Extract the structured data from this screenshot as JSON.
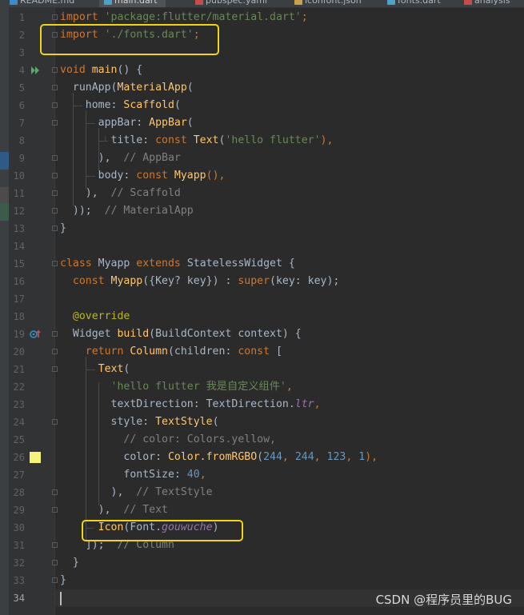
{
  "tabs": [
    {
      "label": "README.md",
      "icon_color": "#3d8bcd",
      "active": false
    },
    {
      "label": "main.dart",
      "icon_color": "#4ba3c7",
      "active": true
    },
    {
      "label": "pubspec.yaml",
      "icon_color": "#c94a4a",
      "active": false
    },
    {
      "label": "iconfont.json",
      "icon_color": "#c9a24a",
      "active": false
    },
    {
      "label": "fonts.dart",
      "icon_color": "#4ba3c7",
      "active": false
    },
    {
      "label": "analysis",
      "icon_color": "#c94a4a",
      "active": false
    }
  ],
  "editor": {
    "current_line": 34,
    "highlight_color": "#f2d316",
    "color_swatch": "#f4f47b",
    "lines": [
      [
        {
          "t": "import ",
          "c": "kw"
        },
        {
          "t": "'package:flutter/material.dart'",
          "c": "str"
        },
        {
          "t": ";",
          "c": "kw"
        }
      ],
      [
        {
          "t": "import ",
          "c": "kw"
        },
        {
          "t": "'./fonts.dart'",
          "c": "str"
        },
        {
          "t": ";",
          "c": "kw"
        }
      ],
      [],
      [
        {
          "t": "void ",
          "c": "kw"
        },
        {
          "t": "main",
          "c": "fn"
        },
        {
          "t": "() {",
          "c": ""
        }
      ],
      [
        {
          "t": "  runApp(",
          "c": ""
        },
        {
          "t": "MaterialApp",
          "c": "fn"
        },
        {
          "t": "(",
          "c": ""
        }
      ],
      [
        {
          "t": "    home: ",
          "c": ""
        },
        {
          "t": "Scaffold",
          "c": "fn"
        },
        {
          "t": "(",
          "c": ""
        }
      ],
      [
        {
          "t": "      appBar: ",
          "c": ""
        },
        {
          "t": "AppBar",
          "c": "fn"
        },
        {
          "t": "(",
          "c": ""
        }
      ],
      [
        {
          "t": "        title: ",
          "c": ""
        },
        {
          "t": "const ",
          "c": "kw"
        },
        {
          "t": "Text",
          "c": "fn"
        },
        {
          "t": "(",
          "c": ""
        },
        {
          "t": "'hello flutter'",
          "c": "str"
        },
        {
          "t": "),",
          "c": "kw"
        }
      ],
      [
        {
          "t": "      ),  ",
          "c": ""
        },
        {
          "t": "// AppBar",
          "c": "cm"
        }
      ],
      [
        {
          "t": "      body: ",
          "c": ""
        },
        {
          "t": "const ",
          "c": "kw"
        },
        {
          "t": "Myapp",
          "c": "fn"
        },
        {
          "t": "(),",
          "c": "kw"
        }
      ],
      [
        {
          "t": "    ),  ",
          "c": ""
        },
        {
          "t": "// Scaffold",
          "c": "cm"
        }
      ],
      [
        {
          "t": "  ));  ",
          "c": ""
        },
        {
          "t": "// MaterialApp",
          "c": "cm"
        }
      ],
      [
        {
          "t": "}",
          "c": ""
        }
      ],
      [],
      [
        {
          "t": "class ",
          "c": "kw"
        },
        {
          "t": "Myapp ",
          "c": ""
        },
        {
          "t": "extends ",
          "c": "kw"
        },
        {
          "t": "StatelessWidget {",
          "c": ""
        }
      ],
      [
        {
          "t": "  const ",
          "c": "kw"
        },
        {
          "t": "Myapp",
          "c": "fn"
        },
        {
          "t": "({Key? key}) : ",
          "c": ""
        },
        {
          "t": "super",
          "c": "kw"
        },
        {
          "t": "(key: key);",
          "c": ""
        }
      ],
      [],
      [
        {
          "t": "  @override",
          "c": "an"
        }
      ],
      [
        {
          "t": "  Widget ",
          "c": ""
        },
        {
          "t": "build",
          "c": "fn"
        },
        {
          "t": "(BuildContext context) {",
          "c": ""
        }
      ],
      [
        {
          "t": "    return ",
          "c": "kw"
        },
        {
          "t": "Column",
          "c": "fn"
        },
        {
          "t": "(children: ",
          "c": ""
        },
        {
          "t": "const ",
          "c": "kw"
        },
        {
          "t": "[",
          "c": ""
        }
      ],
      [
        {
          "t": "      ",
          "c": ""
        },
        {
          "t": "Text",
          "c": "fn"
        },
        {
          "t": "(",
          "c": ""
        }
      ],
      [
        {
          "t": "        ",
          "c": ""
        },
        {
          "t": "'hello flutter 我是自定义组件'",
          "c": "str"
        },
        {
          "t": ",",
          "c": "kw"
        }
      ],
      [
        {
          "t": "        textDirection: TextDirection.",
          "c": ""
        },
        {
          "t": "ltr",
          "c": "field"
        },
        {
          "t": ",",
          "c": "kw"
        }
      ],
      [
        {
          "t": "        style: ",
          "c": ""
        },
        {
          "t": "TextStyle",
          "c": "fn"
        },
        {
          "t": "(",
          "c": ""
        }
      ],
      [
        {
          "t": "          ",
          "c": ""
        },
        {
          "t": "// color: Colors.yellow,",
          "c": "cm"
        }
      ],
      [
        {
          "t": "          color: ",
          "c": ""
        },
        {
          "t": "Color.fromRGBO",
          "c": "fn"
        },
        {
          "t": "(",
          "c": ""
        },
        {
          "t": "244",
          "c": "num"
        },
        {
          "t": ", ",
          "c": "kw"
        },
        {
          "t": "244",
          "c": "num"
        },
        {
          "t": ", ",
          "c": "kw"
        },
        {
          "t": "123",
          "c": "num"
        },
        {
          "t": ", ",
          "c": "kw"
        },
        {
          "t": "1",
          "c": "num"
        },
        {
          "t": "),",
          "c": "kw"
        }
      ],
      [
        {
          "t": "          fontSize: ",
          "c": ""
        },
        {
          "t": "40",
          "c": "num"
        },
        {
          "t": ",",
          "c": "kw"
        }
      ],
      [
        {
          "t": "        ),  ",
          "c": ""
        },
        {
          "t": "// TextStyle",
          "c": "cm"
        }
      ],
      [
        {
          "t": "      ),  ",
          "c": ""
        },
        {
          "t": "// Text",
          "c": "cm"
        }
      ],
      [
        {
          "t": "      ",
          "c": ""
        },
        {
          "t": "Icon",
          "c": "fn"
        },
        {
          "t": "(Font.",
          "c": ""
        },
        {
          "t": "gouwuche",
          "c": "field"
        },
        {
          "t": ")",
          "c": ""
        }
      ],
      [
        {
          "t": "    ]);  ",
          "c": ""
        },
        {
          "t": "// Column",
          "c": "cm"
        }
      ],
      [
        {
          "t": "  }",
          "c": ""
        }
      ],
      [
        {
          "t": "}",
          "c": ""
        }
      ],
      []
    ]
  },
  "watermark": "CSDN @程序员里的BUG"
}
